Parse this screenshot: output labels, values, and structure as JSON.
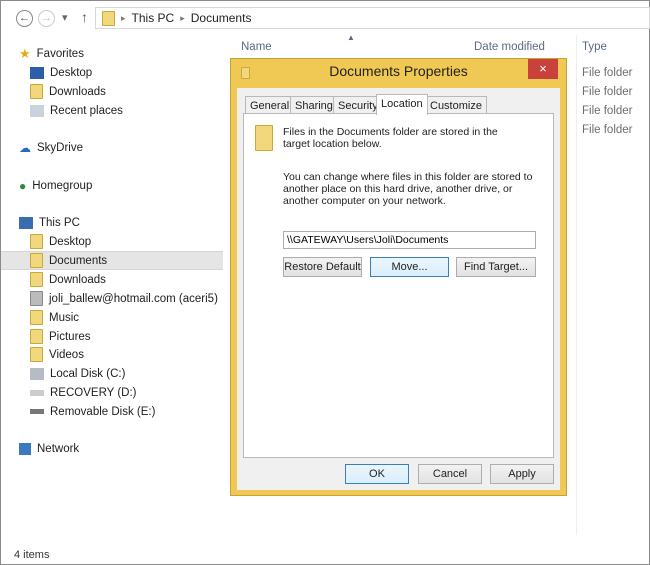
{
  "nav": {
    "back": "←",
    "forward": "→",
    "dropdown": "▾",
    "up": "↑",
    "breadcrumb": [
      "This PC",
      "Documents"
    ],
    "sep": "▸"
  },
  "columns": {
    "name": "Name",
    "date": "Date modified",
    "type": "Type"
  },
  "types": [
    "File folder",
    "File folder",
    "File folder",
    "File folder"
  ],
  "sidebar": [
    {
      "label": "Favorites",
      "icon": "star-icon"
    },
    {
      "label": "Desktop",
      "icon": "desktop-icon"
    },
    {
      "label": "Downloads",
      "icon": "downloads-folder-icon"
    },
    {
      "label": "Recent places",
      "icon": "recent-places-icon"
    },
    {
      "label": "SkyDrive",
      "icon": "cloud-icon"
    },
    {
      "label": "Homegroup",
      "icon": "homegroup-icon"
    },
    {
      "label": "This PC",
      "icon": "computer-icon"
    },
    {
      "label": "Desktop",
      "icon": "folder-icon"
    },
    {
      "label": "Documents",
      "icon": "folder-icon"
    },
    {
      "label": "Downloads",
      "icon": "folder-icon"
    },
    {
      "label": "joli_ballew@hotmail.com (aceri5)",
      "icon": "user-icon"
    },
    {
      "label": "Music",
      "icon": "folder-icon"
    },
    {
      "label": "Pictures",
      "icon": "folder-icon"
    },
    {
      "label": "Videos",
      "icon": "folder-icon"
    },
    {
      "label": "Local Disk (C:)",
      "icon": "drive-icon"
    },
    {
      "label": "RECOVERY (D:)",
      "icon": "drive-icon"
    },
    {
      "label": "Removable Disk (E:)",
      "icon": "removable-drive-icon"
    },
    {
      "label": "Network",
      "icon": "network-icon"
    }
  ],
  "status": "4 items",
  "dialog": {
    "title": "Documents Properties",
    "close": "×",
    "tabs": [
      "General",
      "Sharing",
      "Security",
      "Location",
      "Customize"
    ],
    "active_tab": "Location",
    "info": "Files in the Documents folder are stored in the target location below.",
    "desc": "You can change where files in this folder are stored to another place on this hard drive, another drive, or another computer on your network.",
    "path": "\\\\GATEWAY\\Users\\Joli\\Documents",
    "restore": "Restore Default",
    "move": "Move...",
    "find": "Find Target...",
    "ok": "OK",
    "cancel": "Cancel",
    "apply": "Apply"
  }
}
